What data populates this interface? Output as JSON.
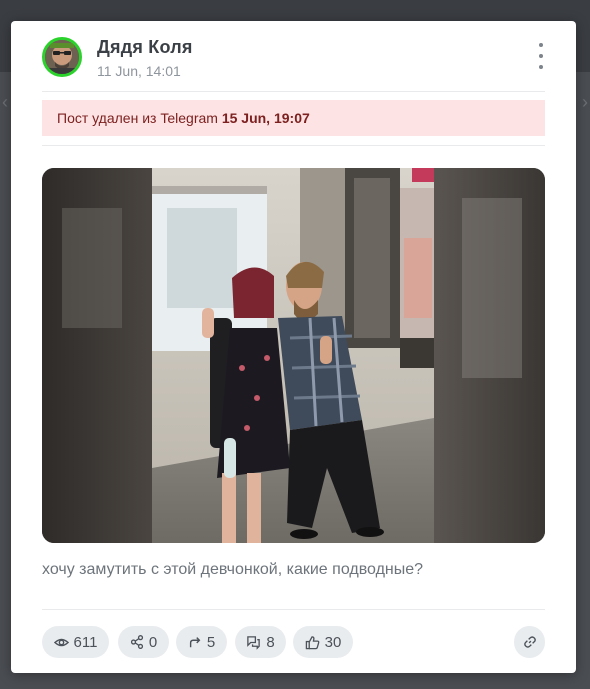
{
  "post": {
    "author": "Дядя Коля",
    "time": "11 Jun, 14:01",
    "alert_prefix": "Пост удален из Telegram",
    "alert_date": "15 Jun, 19:07",
    "caption": "хочу замутить с этой девчонкой, какие подводные?"
  },
  "stats": {
    "views": "611",
    "shares": "0",
    "forwards": "5",
    "comments": "8",
    "likes": "30"
  },
  "icons": {
    "views": "eye-icon",
    "shares": "share-icon",
    "forwards": "forward-arrow-icon",
    "comments": "comments-icon",
    "likes": "thumbs-up-icon",
    "link": "link-icon",
    "menu": "more-vertical-icon"
  },
  "colors": {
    "avatar_ring": "#2bd22b",
    "alert_bg": "#fde3e3",
    "alert_text": "#7d2020",
    "stat_bg": "#e9ecef"
  }
}
